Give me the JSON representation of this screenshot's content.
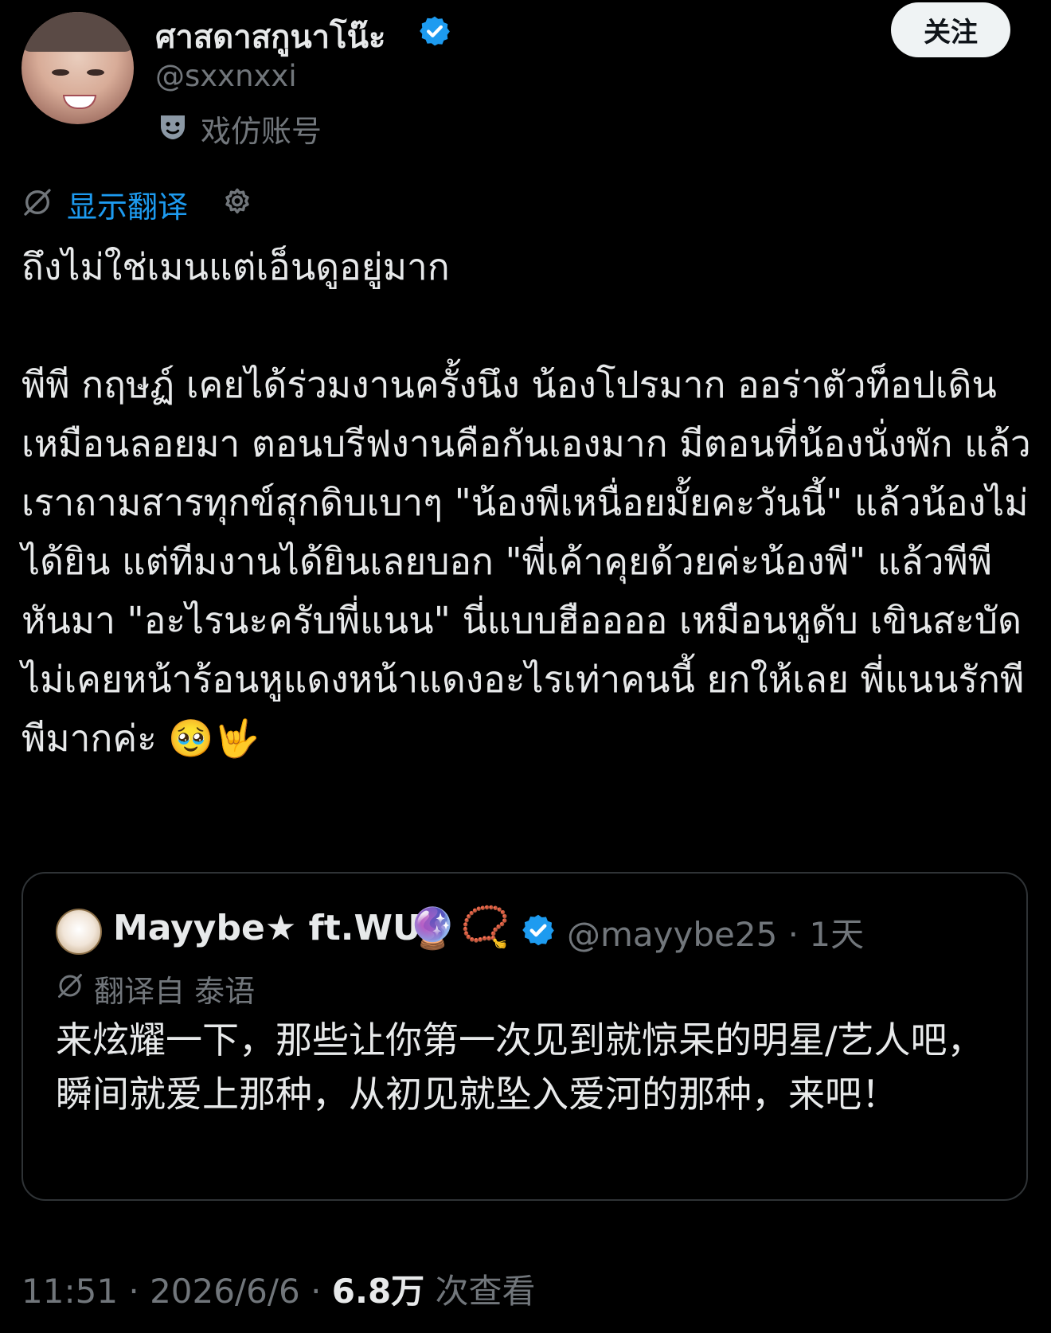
{
  "author": {
    "display_name": "ศาสดาสกูนาโน๊ะ",
    "handle": "@sxxnxxi",
    "parody_label": "戏仿账号",
    "follow_label": "关注"
  },
  "translate": {
    "link_label": "显示翻译"
  },
  "tweet": {
    "text": "ถึงไม่ใช่เมนแต่เอ็นดูอยู่มาก\n\nพีพี กฤษฏ์ เคยได้ร่วมงานครั้งนึง น้องโปรมาก ออร่าตัวท็อปเดินเหมือนลอยมา ตอนบรีฟงานคือกันเองมาก มีตอนที่น้องนั่งพัก แล้วเราถามสารทุกข์สุกดิบเบาๆ \"น้องพีเหนื่อยมั้ยคะวันนี้\" แล้วน้องไม่ได้ยิน แต่ทีมงานได้ยินเลยบอก \"พี่เค้าคุยด้วยค่ะน้องพี\" แล้วพีพีหันมา \"อะไรนะครับพี่แนน\" นี่แบบฮืออออ เหมือนหูดับ เขินสะบัด ไม่เคยหน้าร้อนหูแดงหน้าแดงอะไรเท่าคนนี้ ยกให้เลย พี่แนนรักพีพีมากค่ะ 🥹🤟"
  },
  "quote": {
    "name": "Mayybe★ ft.WU",
    "emoji_1": "🔮",
    "emoji_2": "📿",
    "handle_time": "@mayybe25 · 1天",
    "translated_label": "翻译自 泰语",
    "text": "来炫耀一下，那些让你第一次见到就惊呆的明星/艺人吧，瞬间就爱上那种，从初见就坠入爱河的那种，来吧！"
  },
  "footer": {
    "time_date": "11:51 · 2026/6/6 · ",
    "views_count": "6.8万",
    "views_label": " 次查看"
  },
  "colors": {
    "background": "#000000",
    "text": "#e7e9ea",
    "secondary": "#71767b",
    "link": "#1d9bf0",
    "verified": "#1d9bf0",
    "border": "#2f3336"
  },
  "icons": [
    "verified-badge-icon",
    "parody-mask-icon",
    "translate-icon",
    "gear-icon"
  ]
}
